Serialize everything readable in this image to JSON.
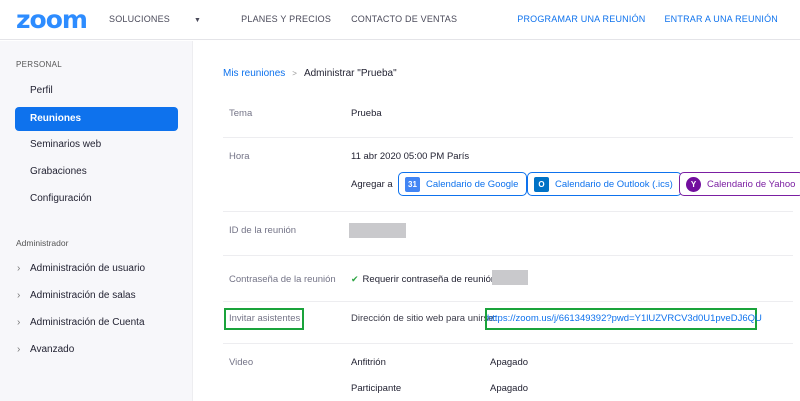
{
  "brand": {
    "logo": "zoom"
  },
  "topnav": {
    "left": [
      "SOLUCIONES",
      "PLANES Y PRECIOS",
      "CONTACTO DE VENTAS"
    ],
    "right": [
      "PROGRAMAR UNA REUNIÓN",
      "ENTRAR A UNA REUNIÓN"
    ]
  },
  "sidebar": {
    "personal_header": "PERSONAL",
    "personal_items": [
      "Perfil",
      "Reuniones",
      "Seminarios web",
      "Grabaciones",
      "Configuración"
    ],
    "admin_header": "Administrador",
    "admin_items": [
      "Administración de usuario",
      "Administración de salas",
      "Administración de Cuenta",
      "Avanzado"
    ]
  },
  "breadcrumb": {
    "link": "Mis reuniones",
    "separator": ">",
    "current": "Administrar \"Prueba\""
  },
  "details": {
    "topic_label": "Tema",
    "topic_value": "Prueba",
    "time_label": "Hora",
    "time_value": "11 abr 2020 05:00 PM París",
    "add_to_label": "Agregar a",
    "calendars": [
      "Calendario de Google",
      "Calendario de Outlook (.ics)",
      "Calendario de Yahoo"
    ],
    "meeting_id_label": "ID de la reunión",
    "password_label": "Contraseña de la reunión",
    "password_value": "Requerir contraseña de reunión",
    "invite_label": "Invitar asistentes",
    "invite_url_label": "Dirección de sitio web para unirse:",
    "invite_url": "https://zoom.us/j/661349392?pwd=Y1lUZVRCV3d0U1pveDJ6QU",
    "video_label": "Video",
    "host_label": "Anfitrión",
    "host_value": "Apagado",
    "participant_label": "Participante",
    "participant_value": "Apagado"
  },
  "colors": {
    "accent": "#0e72ed",
    "highlight": "#1aa33b",
    "yahoo": "#7b1fa2"
  }
}
